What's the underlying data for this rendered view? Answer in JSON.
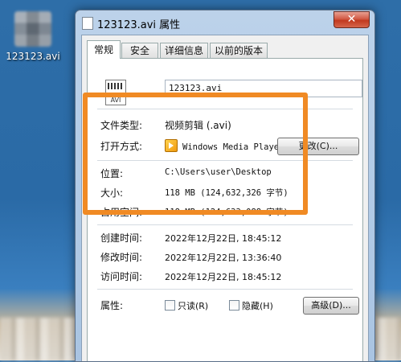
{
  "desktop": {
    "icon_label": "123123.avi"
  },
  "window": {
    "title": "123123.avi 属性",
    "close_glyph": "✕"
  },
  "tabs": [
    {
      "label": "常规",
      "active": true
    },
    {
      "label": "安全"
    },
    {
      "label": "详细信息"
    },
    {
      "label": "以前的版本"
    }
  ],
  "file": {
    "icon_ext": "AVI",
    "name": "123123.avi"
  },
  "props": {
    "type_label": "文件类型:",
    "type_value": "视频剪辑 (.avi)",
    "open_with_label": "打开方式:",
    "open_with_value": "Windows Media Playe",
    "change_button": "更改(C)...",
    "location_label": "位置:",
    "location_value": "C:\\Users\\user\\Desktop",
    "size_label": "大小:",
    "size_value": "118 MB (124,632,326 字节)",
    "size_on_disk_label": "占用空间:",
    "size_on_disk_value": "118 MB (124,633,088 字节)",
    "created_label": "创建时间:",
    "created_value": "2022年12月22日, 18:45:12",
    "modified_label": "修改时间:",
    "modified_value": "2022年12月22日, 13:36:40",
    "accessed_label": "访问时间:",
    "accessed_value": "2022年12月22日, 18:45:12",
    "attributes_label": "属性:",
    "readonly_label": "只读(R)",
    "hidden_label": "隐藏(H)",
    "advanced_button": "高级(D)..."
  },
  "colors": {
    "highlight": "#f08a24"
  }
}
